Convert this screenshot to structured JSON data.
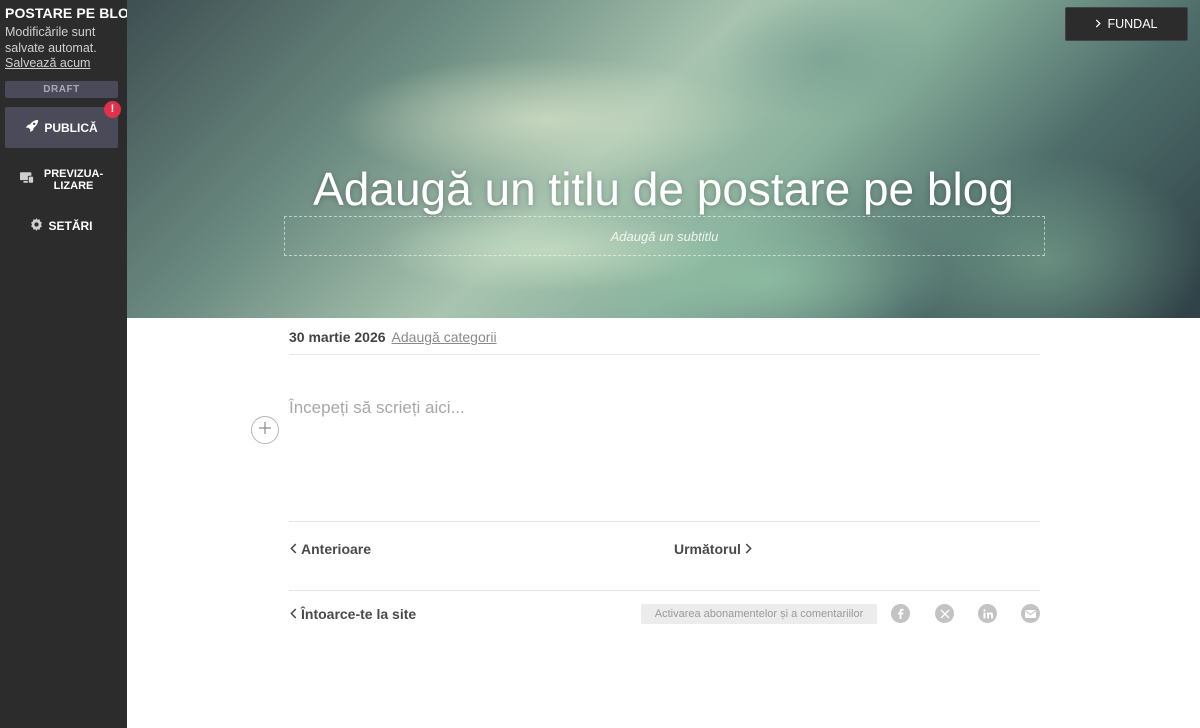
{
  "sidebar": {
    "title": "POSTARE PE BLOG",
    "autosave_note": "Modificările sunt salvate automat.",
    "save_now": "Salvează acum",
    "status": "DRAFT",
    "publish_label": "PUBLICĂ",
    "publish_badge": "!",
    "preview_label_line1": "PREVIZUA-",
    "preview_label_line2": "LIZARE",
    "settings_label": "SETĂRI"
  },
  "hero": {
    "background_button": "FUNDAL",
    "title": "Adaugă un titlu de postare pe blog",
    "subtitle_placeholder": "Adaugă un subtitlu"
  },
  "post": {
    "date": "30 martie 2026",
    "add_categories": "Adaugă categorii",
    "body_placeholder": "Începeți să scrieți aici..."
  },
  "navigation": {
    "previous": "Anterioare",
    "next": "Următorul",
    "back_to_site": "Întoarce-te la site"
  },
  "footer": {
    "subscriptions_toggle": "Activarea abonamentelor și a comentariilor",
    "share_icons": [
      "facebook-icon",
      "x-icon",
      "linkedin-icon",
      "email-icon"
    ]
  },
  "colors": {
    "sidebar_bg": "#2c2c2c",
    "publish_bg": "#4a4a58",
    "badge": "#e0304a",
    "social_icon_bg": "#c3c3c3"
  }
}
